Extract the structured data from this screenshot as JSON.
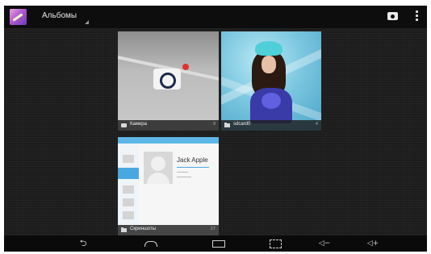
{
  "actionbar": {
    "title": "Альбомы",
    "app_icon": "gallery-icon",
    "camera_icon": "camera-icon",
    "menu_icon": "overflow-menu-icon"
  },
  "albums": [
    {
      "label": "Камера",
      "count": "9",
      "icon": "camera-icon"
    },
    {
      "label": "sdcard0",
      "count": "4",
      "icon": "folder-icon"
    },
    {
      "label": "Скриншоты",
      "count": "27",
      "icon": "folder-icon"
    }
  ],
  "album_thumb": {
    "contact_name": "Jack Apple"
  },
  "navbar": {
    "back": "⮌",
    "vol_down": "◁−",
    "vol_up": "◁+",
    "icons": [
      "back-icon",
      "home-icon",
      "recent-apps-icon",
      "screenshot-icon",
      "volume-down-icon",
      "volume-up-icon"
    ]
  }
}
